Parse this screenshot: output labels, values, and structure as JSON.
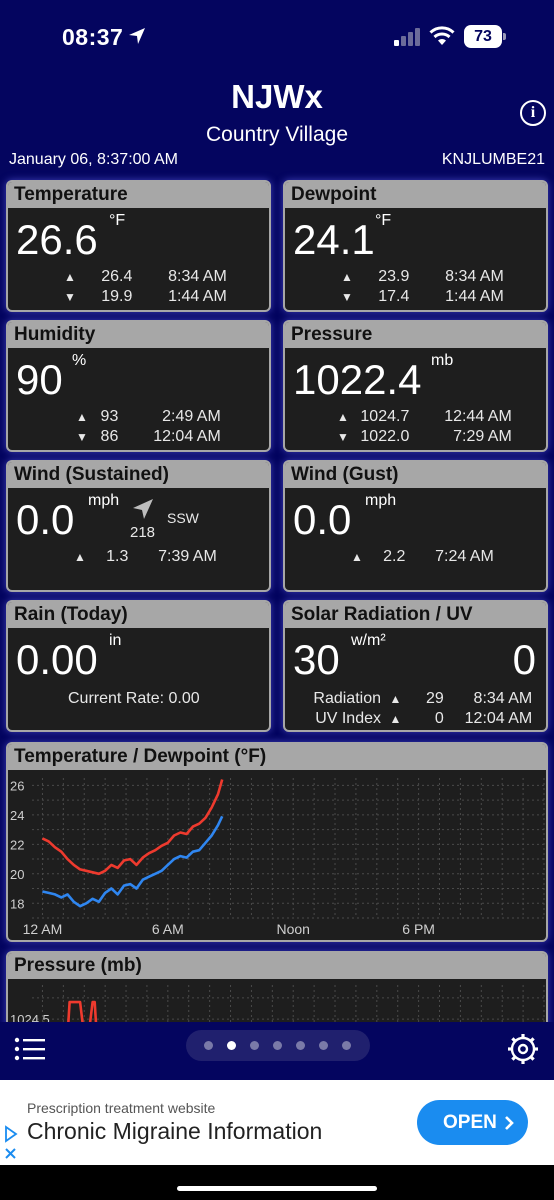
{
  "status_bar": {
    "time": "08:37",
    "battery": "73"
  },
  "header": {
    "title": "NJWx",
    "subtitle": "Country Village",
    "date_time": "January 06, 8:37:00 AM",
    "station_id": "KNJLUMBE21"
  },
  "cards": {
    "temperature": {
      "title": "Temperature",
      "value": "26.6",
      "unit": "°F",
      "high": "26.4",
      "high_time": "8:34 AM",
      "low": "19.9",
      "low_time": "1:44 AM"
    },
    "dewpoint": {
      "title": "Dewpoint",
      "value": "24.1",
      "unit": "°F",
      "high": "23.9",
      "high_time": "8:34 AM",
      "low": "17.4",
      "low_time": "1:44 AM"
    },
    "humidity": {
      "title": "Humidity",
      "value": "90",
      "unit": "%",
      "high": "93",
      "high_time": "2:49 AM",
      "low": "86",
      "low_time": "12:04 AM"
    },
    "pressure": {
      "title": "Pressure",
      "value": "1022.4",
      "unit": "mb",
      "high": "1024.7",
      "high_time": "12:44 AM",
      "low": "1022.0",
      "low_time": "7:29 AM"
    },
    "wind_sustained": {
      "title": "Wind (Sustained)",
      "value": "0.0",
      "unit": "mph",
      "direction_deg": "218",
      "direction": "SSW",
      "high": "1.3",
      "high_time": "7:39 AM"
    },
    "wind_gust": {
      "title": "Wind (Gust)",
      "value": "0.0",
      "unit": "mph",
      "high": "2.2",
      "high_time": "7:24 AM"
    },
    "rain": {
      "title": "Rain (Today)",
      "value": "0.00",
      "unit": "in",
      "rate": "Current Rate: 0.00"
    },
    "solar": {
      "title": "Solar Radiation / UV",
      "value": "30",
      "unit": "w/m²",
      "uv_value": "0",
      "radiation_label": "Radiation",
      "radiation_high": "29",
      "radiation_time": "8:34 AM",
      "uv_label": "UV Index",
      "uv_high": "0",
      "uv_time": "12:04 AM"
    }
  },
  "chart_data": [
    {
      "type": "line",
      "title": "Temperature / Dewpoint (°F)",
      "x_ticks": [
        "12 AM",
        "6 AM",
        "Noon",
        "6 PM"
      ],
      "x_range_hours": [
        -0.5,
        24
      ],
      "y_ticks": [
        18,
        20,
        22,
        24,
        26
      ],
      "ylim": [
        17,
        26.5
      ],
      "grid": true,
      "series": [
        {
          "color": "#ee3a2e",
          "x": [
            0,
            0.3,
            0.6,
            0.9,
            1.2,
            1.5,
            1.8,
            2.1,
            2.4,
            2.7,
            3.0,
            3.3,
            3.6,
            3.9,
            4.2,
            4.5,
            4.8,
            5.1,
            5.4,
            5.7,
            6.0,
            6.3,
            6.6,
            6.9,
            7.2,
            7.5,
            7.8,
            8.1,
            8.4,
            8.6
          ],
          "values": [
            22.4,
            22.2,
            21.8,
            21.5,
            21.0,
            20.6,
            20.3,
            20.2,
            20.1,
            20.0,
            20.2,
            20.6,
            20.4,
            20.9,
            21.0,
            20.6,
            21.1,
            21.4,
            21.6,
            21.9,
            22.1,
            22.6,
            22.8,
            22.7,
            23.2,
            23.4,
            23.8,
            24.5,
            25.4,
            26.4
          ]
        },
        {
          "color": "#2f86f0",
          "x": [
            0,
            0.3,
            0.6,
            0.9,
            1.2,
            1.5,
            1.8,
            2.1,
            2.4,
            2.7,
            3.0,
            3.3,
            3.6,
            3.9,
            4.2,
            4.5,
            4.8,
            5.1,
            5.4,
            5.7,
            6.0,
            6.3,
            6.6,
            6.9,
            7.2,
            7.5,
            7.8,
            8.1,
            8.4,
            8.6
          ],
          "values": [
            18.8,
            18.7,
            18.6,
            18.4,
            18.6,
            18.1,
            17.8,
            18.0,
            18.3,
            18.1,
            18.7,
            19.0,
            18.6,
            19.2,
            19.3,
            19.0,
            19.6,
            19.8,
            20.0,
            20.2,
            20.6,
            21.0,
            21.2,
            21.1,
            21.5,
            21.6,
            22.1,
            22.6,
            23.3,
            23.9
          ]
        }
      ]
    },
    {
      "type": "line",
      "title": "Pressure (mb)",
      "y_ticks": [
        1024.5
      ],
      "ylim": [
        1023.8,
        1024.9
      ],
      "grid": true,
      "series": [
        {
          "color": "#ee3a2e",
          "x": [
            1.0,
            1.2,
            1.3,
            1.4,
            1.6,
            1.8,
            2.0,
            2.2,
            2.4,
            2.5,
            2.6,
            2.8,
            3.0,
            3.1,
            3.2
          ],
          "values": [
            1024.3,
            1024.3,
            1024.7,
            1024.7,
            1024.7,
            1024.7,
            1024.3,
            1024.3,
            1024.7,
            1024.7,
            1024.3,
            1024.3,
            1024.0,
            1024.3,
            1024.0
          ]
        }
      ]
    }
  ],
  "nav": {
    "page_count": 7,
    "active_page": 1
  },
  "ad": {
    "label": "Prescription treatment website",
    "title": "Chronic Migraine Information",
    "button": "OPEN"
  }
}
